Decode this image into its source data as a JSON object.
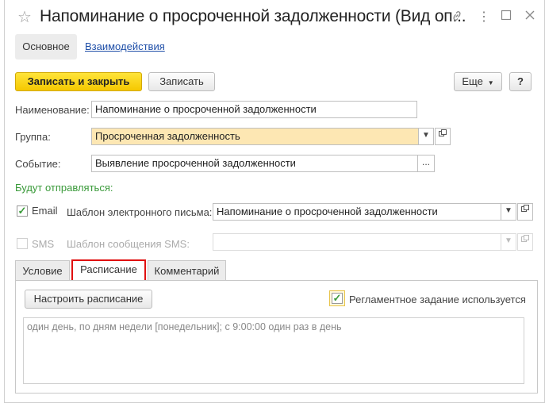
{
  "window": {
    "title": "Напоминание о просроченной задолженности (Вид оп..."
  },
  "nav": {
    "tabs": [
      {
        "label": "Основное"
      },
      {
        "label": "Взаимодействия"
      }
    ]
  },
  "toolbar": {
    "save_close_label": "Записать и закрыть",
    "save_label": "Записать",
    "more_label": "Еще",
    "help_label": "?"
  },
  "form": {
    "name_label": "Наименование:",
    "name_value": "Напоминание о просроченной задолженности",
    "group_label": "Группа:",
    "group_value": "Просроченная задолженность",
    "event_label": "Событие:",
    "event_value": "Выявление просроченной задолженности",
    "send_header": "Будут отправляться:",
    "email_label": "Email",
    "email_template_label": "Шаблон электронного письма:",
    "email_template_value": "Напоминание о просроченной задолженности",
    "sms_label": "SMS",
    "sms_template_label": "Шаблон сообщения SMS:",
    "sms_template_value": ""
  },
  "tabs": [
    {
      "label": "Условие"
    },
    {
      "label": "Расписание"
    },
    {
      "label": "Комментарий"
    }
  ],
  "schedule": {
    "configure_button": "Настроить расписание",
    "routine_task_label": "Регламентное задание используется",
    "routine_task_checked": true,
    "description": "один день, по дням недели [понедельник]; с 9:00:00 один раз в день"
  },
  "colors": {
    "accent_yellow": "#f5c800",
    "highlight_field": "#fde7b3",
    "green_text": "#3a9a3a",
    "active_tab_border": "#e01010",
    "link": "#1f4fa8"
  }
}
